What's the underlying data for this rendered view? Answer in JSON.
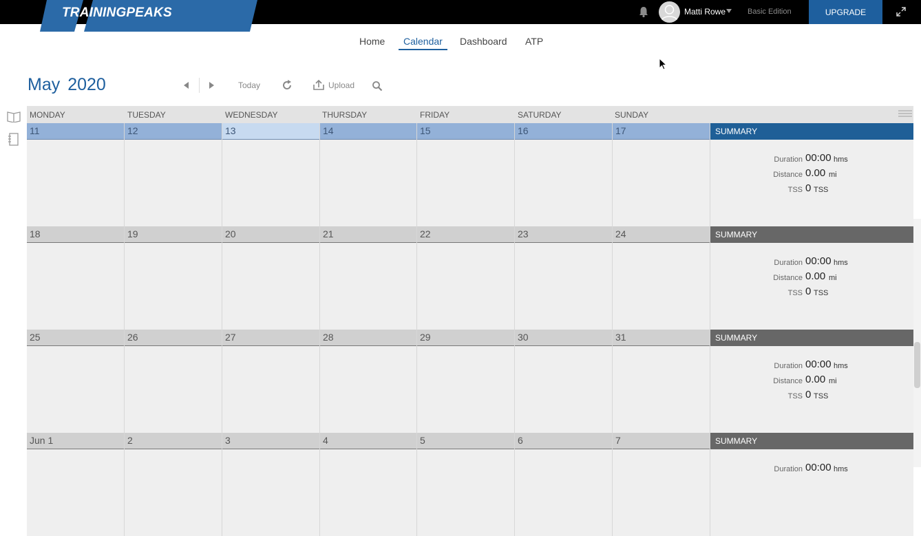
{
  "topbar": {
    "logo": "TRAININGPEAKS",
    "user_name": "Matti Rowe",
    "edition": "Basic Edition",
    "upgrade_label": "UPGRADE",
    "icons": [
      "bell-icon",
      "avatar",
      "user-caret-icon",
      "expand-icon"
    ]
  },
  "nav": {
    "items": [
      {
        "label": "Home"
      },
      {
        "label": "Calendar"
      },
      {
        "label": "Dashboard"
      },
      {
        "label": "ATP"
      }
    ],
    "active": "Calendar"
  },
  "toolbar": {
    "month": "May",
    "year": "2020",
    "today_label": "Today",
    "upload_label": "Upload",
    "icons": [
      "prev-arrow-icon",
      "next-arrow-icon",
      "refresh-icon",
      "upload-icon",
      "search-icon"
    ]
  },
  "sidebar": {
    "icons": [
      "library-book-icon",
      "notebook-icon"
    ]
  },
  "calendar": {
    "day_names": [
      "MONDAY",
      "TUESDAY",
      "WEDNESDAY",
      "THURSDAY",
      "FRIDAY",
      "SATURDAY",
      "SUNDAY"
    ],
    "summary_label": "SUMMARY",
    "weeks": [
      {
        "dates": [
          "11",
          "12",
          "13",
          "14",
          "15",
          "16",
          "17"
        ],
        "current": true,
        "today_index": 2,
        "summary": {
          "duration_label": "Duration",
          "duration": "00:00",
          "duration_unit": "hms",
          "distance_label": "Distance",
          "distance": "0.00",
          "distance_unit": "mi",
          "tss_label": "TSS",
          "tss": "0",
          "tss_unit": "TSS"
        }
      },
      {
        "dates": [
          "18",
          "19",
          "20",
          "21",
          "22",
          "23",
          "24"
        ],
        "current": false,
        "summary": {
          "duration_label": "Duration",
          "duration": "00:00",
          "duration_unit": "hms",
          "distance_label": "Distance",
          "distance": "0.00",
          "distance_unit": "mi",
          "tss_label": "TSS",
          "tss": "0",
          "tss_unit": "TSS"
        }
      },
      {
        "dates": [
          "25",
          "26",
          "27",
          "28",
          "29",
          "30",
          "31"
        ],
        "current": false,
        "summary": {
          "duration_label": "Duration",
          "duration": "00:00",
          "duration_unit": "hms",
          "distance_label": "Distance",
          "distance": "0.00",
          "distance_unit": "mi",
          "tss_label": "TSS",
          "tss": "0",
          "tss_unit": "TSS"
        }
      },
      {
        "dates": [
          "Jun 1",
          "2",
          "3",
          "4",
          "5",
          "6",
          "7"
        ],
        "current": false,
        "summary": {
          "duration_label": "Duration",
          "duration": "00:00",
          "duration_unit": "hms"
        }
      }
    ]
  },
  "colors": {
    "brand_blue": "#1e5f9e",
    "current_week": "#93b1d8",
    "summary_current": "#1f5f97",
    "summary_other": "#676767"
  }
}
